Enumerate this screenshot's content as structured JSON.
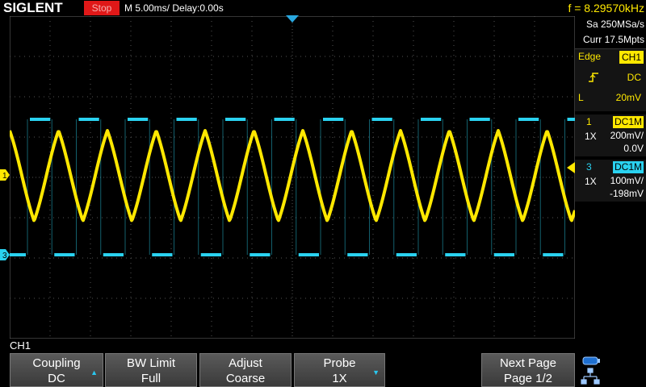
{
  "header": {
    "logo": "SIGLENT",
    "run_status": "Stop",
    "timebase": "M 5.00ms/ Delay:0.00s",
    "frequency": "f = 8.29570kHz"
  },
  "acquisition": {
    "sample_rate": "Sa 250MSa/s",
    "memory_depth": "Curr 17.5Mpts"
  },
  "trigger": {
    "mode": "Edge",
    "source": "CH1",
    "coupling": "DC",
    "level_label": "L",
    "level": "20mV"
  },
  "channels": [
    {
      "number": "1",
      "coupling": "DC1M",
      "probe": "1X",
      "scale": "200mV/",
      "offset": "0.0V",
      "color": "#ffe800",
      "marker": "1"
    },
    {
      "number": "3",
      "coupling": "DC1M",
      "probe": "1X",
      "scale": "100mV/",
      "offset": "-198mV",
      "color": "#2ad2f0",
      "marker": "3"
    }
  ],
  "menu": {
    "title": "CH1",
    "softkeys": [
      {
        "line1": "Coupling",
        "line2": "DC"
      },
      {
        "line1": "BW Limit",
        "line2": "Full"
      },
      {
        "line1": "Adjust",
        "line2": "Coarse"
      },
      {
        "line1": "Probe",
        "line2": "1X"
      },
      {
        "line1": "Next Page",
        "line2": "Page 1/2"
      }
    ]
  },
  "icons": {
    "slope": "rising-edge-icon",
    "up_arrow": "triangle-up-icon",
    "down_arrow": "triangle-down-icon",
    "usb": "usb-icon",
    "network": "network-icon"
  },
  "colors": {
    "ch1": "#ffe800",
    "ch3": "#2ad2f0",
    "stop": "#e01818",
    "accent": "#29c8f0"
  }
}
